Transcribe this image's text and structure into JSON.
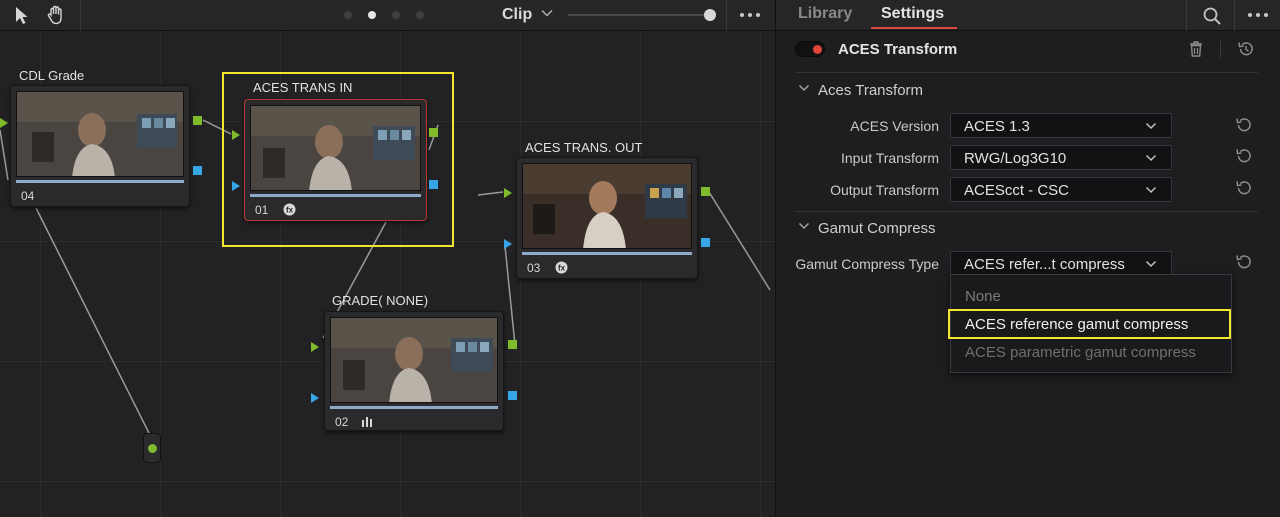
{
  "toolbar": {
    "clip_label": "Clip",
    "tools": [
      "pointer-icon",
      "hand-icon"
    ],
    "page_dots": 4,
    "active_page": 2
  },
  "nodes": {
    "cdl": {
      "title": "CDL Grade",
      "number": "04"
    },
    "aces_in": {
      "title": "ACES TRANS IN",
      "number": "01"
    },
    "grade": {
      "title": "GRADE( NONE)",
      "number": "02"
    },
    "aces_out": {
      "title": "ACES TRANS. OUT",
      "number": "03"
    }
  },
  "panel": {
    "tabs": {
      "library": "Library",
      "settings": "Settings",
      "active": "Settings"
    },
    "effect_title": "ACES Transform",
    "sections": {
      "aces_transform": "Aces Transform",
      "gamut_compress": "Gamut Compress"
    },
    "fields": {
      "aces_version": {
        "label": "ACES Version",
        "value": "ACES 1.3"
      },
      "input_transform": {
        "label": "Input Transform",
        "value": "RWG/Log3G10"
      },
      "output_transform": {
        "label": "Output Transform",
        "value": "ACEScct - CSC"
      },
      "gamut_compress_type": {
        "label": "Gamut Compress Type",
        "value": "ACES refer...t compress"
      }
    },
    "gamut_menu": {
      "options": [
        "None",
        "ACES reference gamut compress",
        "ACES parametric gamut compress"
      ],
      "highlighted": "ACES reference gamut compress"
    }
  },
  "colors": {
    "accent_red": "#d8473f",
    "highlight_yellow": "#f2e52a",
    "port_green": "#7fbb2a",
    "port_blue": "#36a6e6"
  }
}
